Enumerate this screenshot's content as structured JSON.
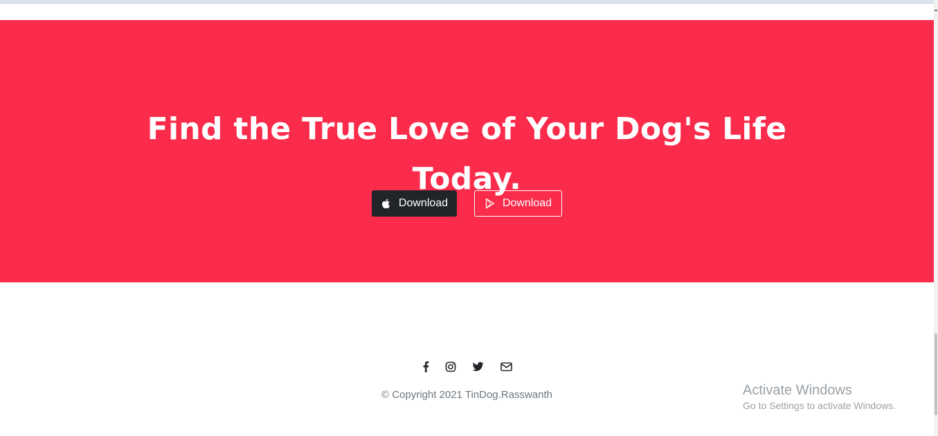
{
  "cta": {
    "heading_line1": "Find the True Love of Your Dog's Life",
    "heading_line2": "Today.",
    "buttons": [
      {
        "label": "Download",
        "icon": "apple-icon",
        "style": "dark"
      },
      {
        "label": "Download",
        "icon": "google-play-icon",
        "style": "outline"
      }
    ],
    "background_color": "#fa2b4b"
  },
  "footer": {
    "social_icons": [
      "facebook-icon",
      "instagram-icon",
      "twitter-icon",
      "envelope-icon"
    ],
    "copyright": "© Copyright 2021 TinDog.Rasswanth"
  },
  "os_watermark": {
    "title": "Activate Windows",
    "subtitle": "Go to Settings to activate Windows."
  }
}
